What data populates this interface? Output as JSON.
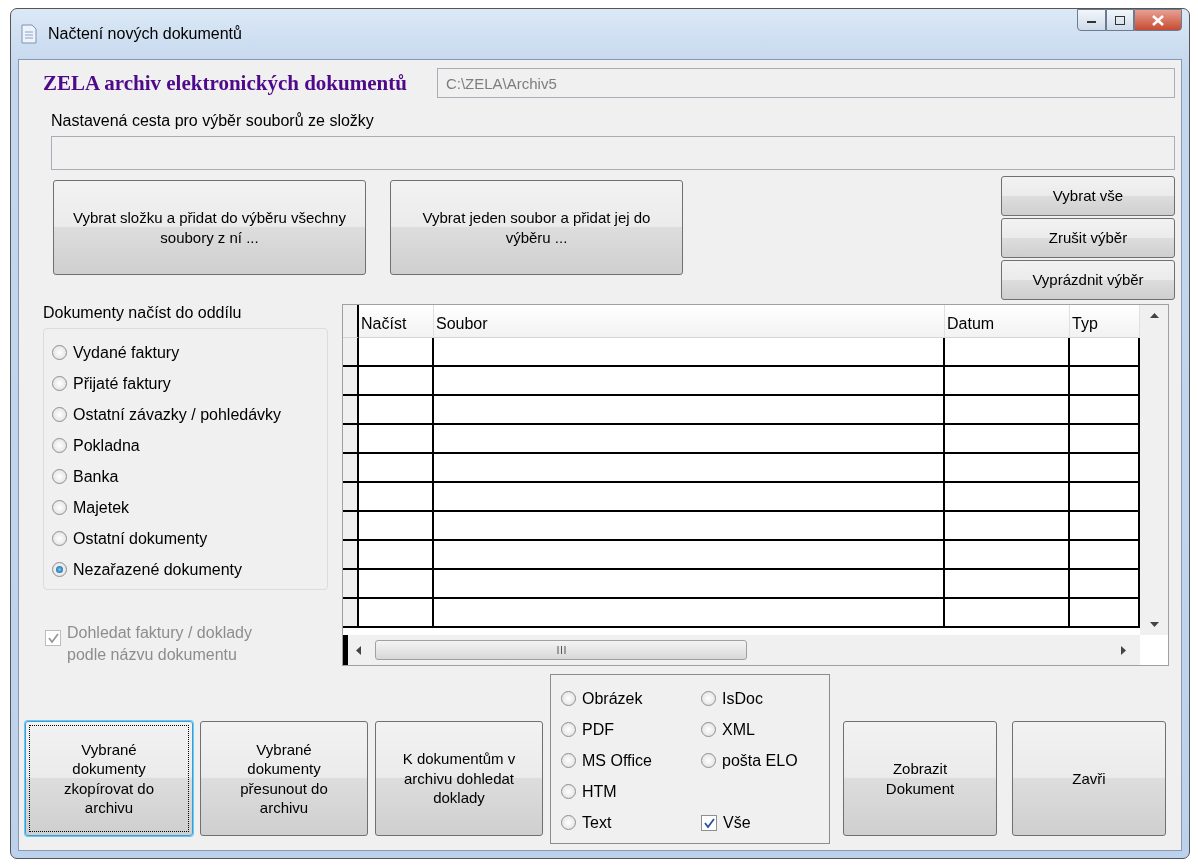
{
  "window": {
    "title": "Načtení nových dokumentů"
  },
  "header": {
    "title": "ZELA archiv elektronických dokumentů",
    "archive_path": "C:\\ZELA\\Archiv5"
  },
  "folder_path": {
    "label": "Nastavená cesta pro výběr souborů ze složky"
  },
  "select_buttons": [
    "Vybrat složku a přidat do výběru všechny soubory z ní ...",
    "Vybrat jeden soubor a přidat jej do výběru ..."
  ],
  "selection_buttons": [
    "Vybrat vše",
    "Zrušit výběr",
    "Vyprázdnit výběr"
  ],
  "section": {
    "label": "Dokumenty načíst do oddílu",
    "options": [
      {
        "label": "Vydané faktury",
        "selected": false
      },
      {
        "label": "Přijaté faktury",
        "selected": false
      },
      {
        "label": "Ostatní závazky / pohledávky",
        "selected": false
      },
      {
        "label": "Pokladna",
        "selected": false
      },
      {
        "label": "Banka",
        "selected": false
      },
      {
        "label": "Majetek",
        "selected": false
      },
      {
        "label": "Ostatní dokumenty",
        "selected": false
      },
      {
        "label": "Nezařazené dokumenty",
        "selected": true
      }
    ]
  },
  "find_by_name": {
    "label": "Dohledat faktury / doklady podle názvu dokumentu",
    "checked": true,
    "disabled": true
  },
  "table": {
    "columns": [
      "Načíst",
      "Soubor",
      "Datum",
      "Typ"
    ]
  },
  "action_buttons": [
    {
      "label": "Vybrané dokumenty zkopírovat do archivu",
      "focused": true
    },
    {
      "label": "Vybrané dokumenty přesunout do archivu",
      "focused": false
    },
    {
      "label": "K dokumentům v archivu dohledat doklady",
      "focused": false
    }
  ],
  "file_types": [
    {
      "kind": "radio",
      "label": "Obrázek",
      "selected": false
    },
    {
      "kind": "radio",
      "label": "IsDoc",
      "selected": false
    },
    {
      "kind": "radio",
      "label": "PDF",
      "selected": false
    },
    {
      "kind": "radio",
      "label": "XML",
      "selected": false
    },
    {
      "kind": "radio",
      "label": "MS Office",
      "selected": false
    },
    {
      "kind": "radio",
      "label": "pošta ELO",
      "selected": false
    },
    {
      "kind": "radio",
      "label": "HTM",
      "selected": false
    },
    {
      "kind": "empty"
    },
    {
      "kind": "radio",
      "label": "Text",
      "selected": false
    },
    {
      "kind": "checkbox",
      "label": "Vše",
      "checked": true
    }
  ],
  "view_button": "Zobrazit Dokument",
  "close_button": "Zavři"
}
